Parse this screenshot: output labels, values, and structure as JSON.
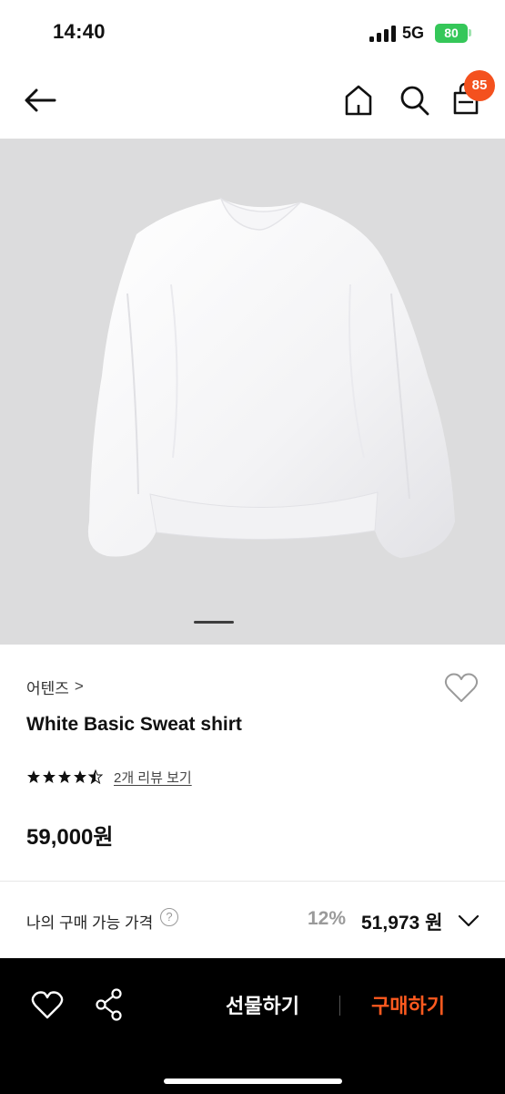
{
  "status_bar": {
    "time": "14:40",
    "network": "5G",
    "battery": "80"
  },
  "header": {
    "back_icon": "arrow-left-icon",
    "home_icon": "home-icon",
    "search_icon": "search-icon",
    "cart_icon": "shopping-bag-icon",
    "cart_count": "85"
  },
  "product": {
    "image_alt_icon": "white-sweatshirt",
    "brand": "어텐즈",
    "brand_chevron": ">",
    "name": "White Basic Sweat shirt",
    "rating": 4.5,
    "review_link": "2개 리뷰 보기",
    "price": "59,000원"
  },
  "my_price": {
    "label": "나의 구매 가능 가격",
    "help": "?",
    "discount": "12%",
    "price": "51,973 원"
  },
  "bottom_bar": {
    "gift_label": "선물하기",
    "buy_label": "구매하기"
  },
  "colors": {
    "accent": "#ff5a1f",
    "badge": "#f4511e",
    "battery": "#35c759"
  }
}
